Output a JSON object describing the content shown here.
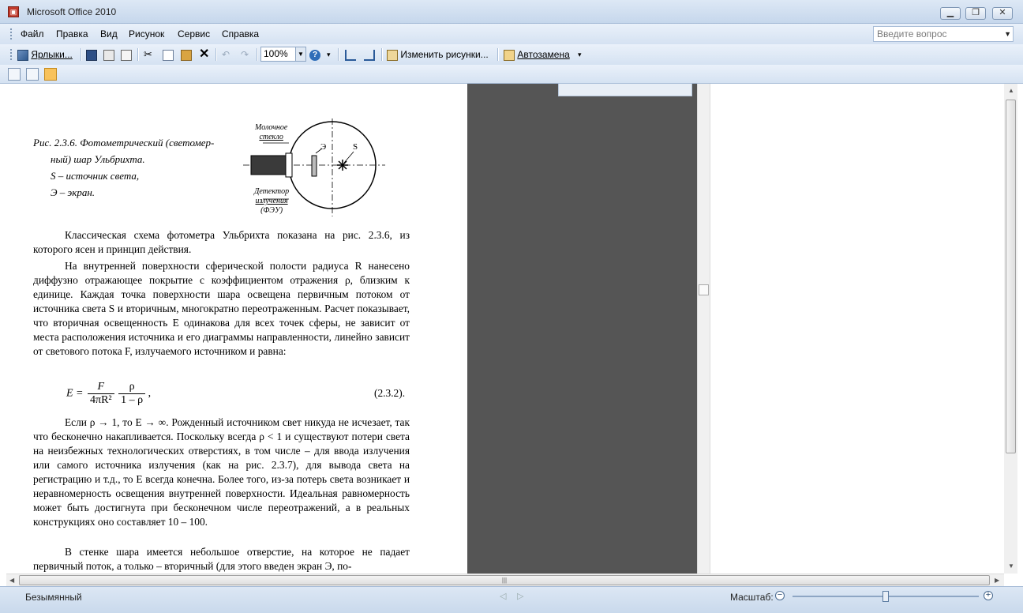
{
  "window": {
    "title": "Microsoft Office 2010"
  },
  "menu": {
    "items": [
      "Файл",
      "Правка",
      "Вид",
      "Рисунок",
      "Сервис",
      "Справка"
    ],
    "ask_placeholder": "Введите вопрос"
  },
  "toolbar": {
    "shortcuts_label": "Ярлыки...",
    "zoom": "100%",
    "edit_pictures_label": "Изменить рисунки...",
    "autocorrect_label": "Автозамена"
  },
  "document": {
    "caption_line1": "Рис. 2.3.6. Фотометрический (светомер-",
    "caption_line2": "ный) шар Ульбрихта.",
    "caption_line3": "S – источник света,",
    "caption_line4": "Э – экран.",
    "fig_labels": {
      "glass1": "Молочное",
      "glass2": "стекло",
      "screen": "Э",
      "source": "S",
      "det1": "Детектор",
      "det2": "излучения",
      "det3": "(ФЭУ)"
    },
    "p1": "Классическая схема фотометра Ульбрихта показана на рис. 2.3.6, из которого ясен и принцип действия.",
    "p2": "На внутренней поверхности сферической полости радиуса R нанесено диффузно отражающее покрытие с коэффициентом отражения ρ, близким к единице. Каждая точка поверхности шара освещена первичным потоком от источника света S и вторичным, многократно переотраженным. Расчет показывает, что вторичная освещенность E одинакова для всех точек сферы, не зависит от места расположения источника и его диаграммы направленности, линейно зависит от светового потока F, излучаемого источником и равна:",
    "formula": {
      "lhs": "E =",
      "num1": "F",
      "den1": "4πR²",
      "num2": "ρ",
      "den2": "1 – ρ",
      "tail": ","
    },
    "eq_number": "(2.3.2).",
    "p3": "Если ρ → 1, то E → ∞. Рожденный источником свет никуда не исчезает, так что бесконечно накапливается. Поскольку всегда ρ < 1 и существуют потери света на неизбежных технологических отверстиях, в том числе – для ввода излучения или самого источника излучения (как на рис. 2.3.7), для вывода света на регистрацию и т.д., то E всегда конечна. Более того, из-за потерь света возникает и неравномерность освещения внутренней поверхности. Идеальная равномерность может быть достигнута при бесконечном числе переотражений, а в реальных конструкциях оно составляет 10 – 100.",
    "p4": "В стенке шара имеется небольшое отверстие, на которое не падает первичный поток, а только – вторичный (для этого введен экран Э, по-"
  },
  "statusbar": {
    "filename": "Безымянный",
    "zoom_label": "Масштаб:",
    "zoom_level": 0.5
  },
  "colors": {
    "accent": "#f8c25b",
    "chrome": "#d5e2f2",
    "dark_pane": "#555555"
  }
}
